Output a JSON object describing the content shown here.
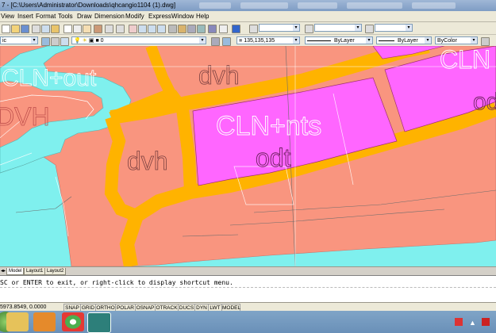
{
  "titlebar": {
    "title": "7 - [C:\\Users\\Administrator\\Downloads\\qhcangio1104 (1).dwg]"
  },
  "menu": [
    "View",
    "Insert",
    "Format",
    "Tools",
    "Draw",
    "Dimension",
    "Modify",
    "Express",
    "Window",
    "Help"
  ],
  "toolbar": {
    "style_combo": "ic",
    "layer_combo": "0",
    "color_value": "135,135,135",
    "linetype": "ByLayer",
    "lineweight": "ByLayer",
    "plotstyle": "ByColor"
  },
  "drawing": {
    "labels": {
      "cln_out": "CLN+out",
      "dvh_left": "DVH",
      "dvh_top": "dvh",
      "dvh_mid": "dvh",
      "cln_nts": "CLN+nts",
      "odt_center": "odt",
      "cln_right": "CLN",
      "odt_right": "od"
    },
    "colors": {
      "water": "#7ff0ee",
      "land": "#f9957f",
      "road": "#ffb300",
      "zone": "#ff66ff"
    }
  },
  "tabs": [
    "Model",
    "Layout1",
    "Layout2"
  ],
  "command": {
    "line1": "SC or ENTER to exit, or right-click to display shortcut menu."
  },
  "status": {
    "coordinates": "5973.8549, 0.0000",
    "buttons": [
      "SNAP",
      "GRID",
      "ORTHO",
      "POLAR",
      "OSNAP",
      "OTRACK",
      "DUCS",
      "DYN",
      "LWT",
      "MODEL"
    ]
  },
  "taskbar": {
    "apps": [
      "file-explorer",
      "media-player",
      "chrome",
      "autocad"
    ]
  }
}
